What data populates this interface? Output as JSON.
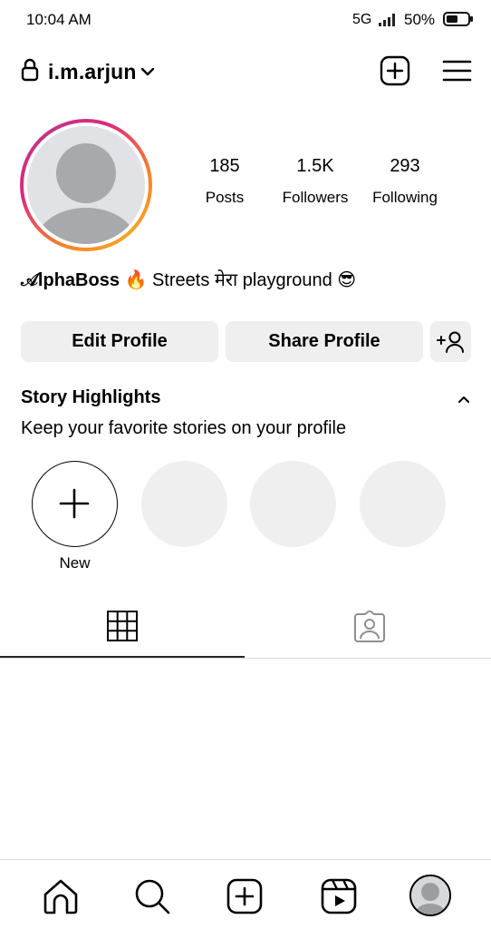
{
  "status_bar": {
    "time": "10:04 AM",
    "network": "5G",
    "battery": "50%"
  },
  "header": {
    "username": "i.m.arjun"
  },
  "stats": [
    {
      "value": "185",
      "label": "Posts"
    },
    {
      "value": "1.5K",
      "label": "Followers"
    },
    {
      "value": "293",
      "label": "Following"
    }
  ],
  "bio": {
    "name": "𝒜lphaBoss",
    "text": " 🔥 Streets मेरा playground 😎"
  },
  "buttons": {
    "edit": "Edit Profile",
    "share": "Share Profile"
  },
  "highlights": {
    "title": "Story Highlights",
    "subtitle": "Keep your favorite stories on your profile",
    "new_label": "New"
  },
  "icons": {
    "lock": "lock-icon",
    "chevron": "chevron-down-icon",
    "create": "plus-square-icon",
    "menu": "hamburger-menu-icon",
    "discover": "add-person-icon",
    "collapse": "chevron-up-icon",
    "grid": "grid-icon",
    "tagged": "tagged-person-icon",
    "home": "home-icon",
    "search": "search-icon",
    "reels": "reels-icon"
  },
  "colors": {
    "button_bg": "#efefef",
    "ring_start": "#f58529",
    "ring_end": "#dd2a7b"
  }
}
